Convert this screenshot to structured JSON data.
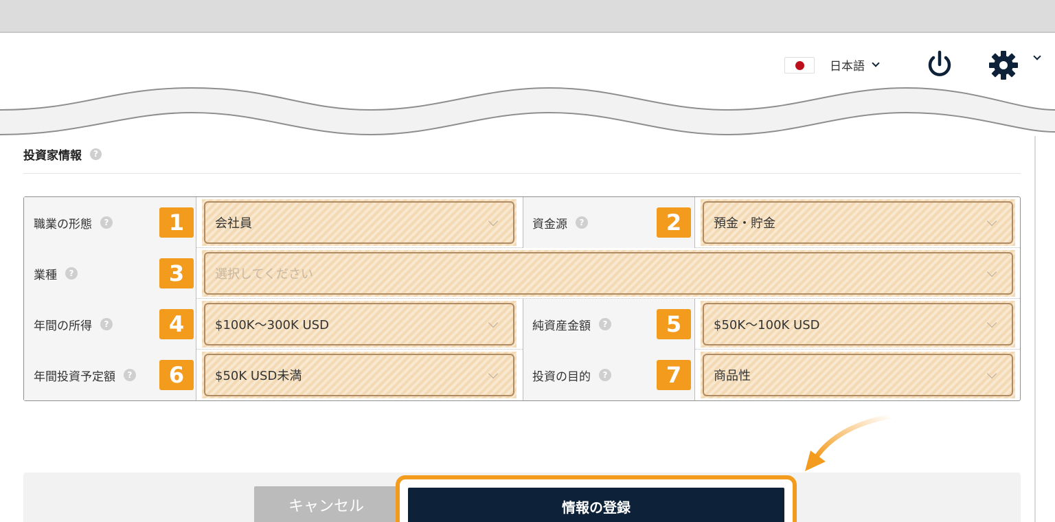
{
  "header": {
    "language_label": "日本語"
  },
  "section": {
    "title": "投資家情報",
    "help": "?"
  },
  "fields": [
    {
      "num": "1",
      "label": "職業の形態",
      "value": "会社員"
    },
    {
      "num": "2",
      "label": "資金源",
      "value": "預金・貯金"
    },
    {
      "num": "3",
      "label": "業種",
      "value": "選択してください"
    },
    {
      "num": "4",
      "label": "年間の所得",
      "value": "$100K～300K USD"
    },
    {
      "num": "5",
      "label": "純資産金額",
      "value": "$50K～100K USD"
    },
    {
      "num": "6",
      "label": "年間投資予定額",
      "value": "$50K USD未満"
    },
    {
      "num": "7",
      "label": "投資の目的",
      "value": "商品性"
    }
  ],
  "buttons": {
    "cancel": "キャンセル",
    "submit": "情報の登録"
  },
  "colors": {
    "accent": "#f39b1d",
    "primary": "#0d2238",
    "highlight": "#f3d9b4"
  },
  "icons": [
    "flag-japan-icon",
    "chevron-down-icon",
    "power-icon",
    "gear-icon",
    "help-icon",
    "curved-arrow-icon"
  ]
}
